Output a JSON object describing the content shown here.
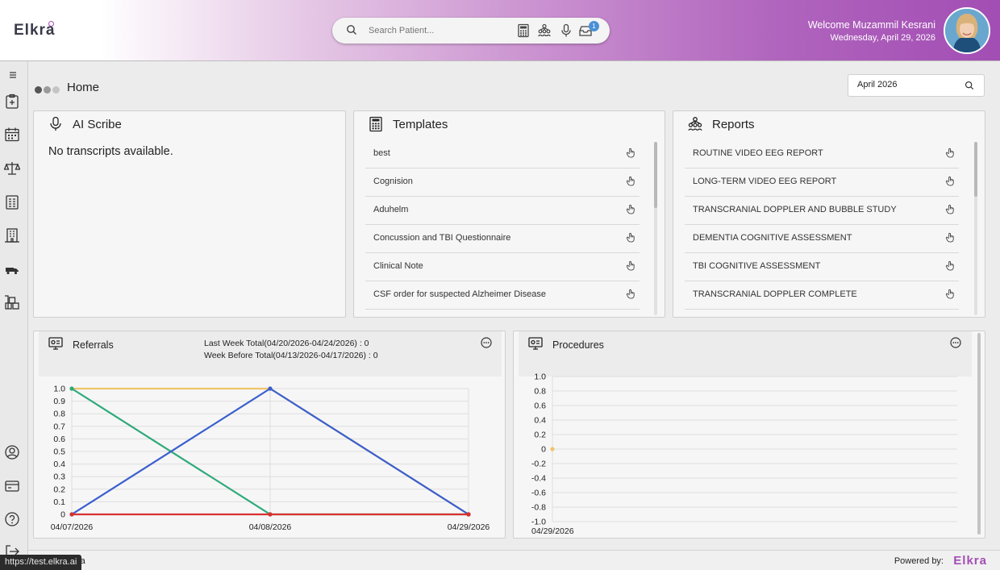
{
  "app": {
    "logo": "Elkra"
  },
  "header": {
    "search_placeholder": "Search Patient...",
    "notification_count": "1",
    "welcome": "Welcome Muzammil Kesrani",
    "date": "Wednesday, April 29, 2026"
  },
  "page": {
    "title": "Home",
    "month_value": "April 2026"
  },
  "ai_scribe": {
    "title": "AI Scribe",
    "empty": "No transcripts available."
  },
  "templates": {
    "title": "Templates",
    "items": [
      "best",
      "Cognision",
      "Aduhelm",
      "Concussion and TBI Questionnaire",
      "Clinical Note",
      "CSF order for suspected Alzheimer Disease"
    ]
  },
  "reports": {
    "title": "Reports",
    "items": [
      "ROUTINE VIDEO EEG REPORT",
      "LONG-TERM VIDEO EEG REPORT",
      "TRANSCRANIAL DOPPLER AND BUBBLE STUDY",
      "DEMENTIA COGNITIVE ASSESSMENT",
      "TBI COGNITIVE ASSESSMENT",
      "TRANSCRANIAL DOPPLER COMPLETE"
    ]
  },
  "referrals": {
    "title": "Referrals",
    "last_week": "Last Week Total(04/20/2026-04/24/2026) : 0",
    "week_before": "Week Before Total(04/13/2026-04/17/2026) : 0"
  },
  "procedures": {
    "title": "Procedures"
  },
  "footer": {
    "powered_by": "Powered by:",
    "logo": "Elkra",
    "url": "https://test.elkra.ai",
    "fragment": "ra"
  },
  "colors": {
    "accent": "#a24eb4",
    "series_yellow": "#efc46a",
    "series_green": "#2eaa7a",
    "series_blue": "#3a5fcf",
    "series_red": "#d93030"
  },
  "chart_data": [
    {
      "type": "line",
      "categories": [
        "04/07/2026",
        "04/08/2026",
        "04/29/2026"
      ],
      "y_ticks": [
        "1.0",
        "0.9",
        "0.8",
        "0.7",
        "0.6",
        "0.5",
        "0.4",
        "0.3",
        "0.2",
        "0.1",
        "0"
      ],
      "ylim": [
        0,
        1
      ],
      "grid": true,
      "series": [
        {
          "color": "#efc46a",
          "values": [
            1,
            1,
            0
          ]
        },
        {
          "color": "#2eaa7a",
          "values": [
            1,
            0,
            0
          ]
        },
        {
          "color": "#3a5fcf",
          "values": [
            0,
            1,
            0
          ]
        },
        {
          "color": "#d93030",
          "values": [
            0,
            0,
            0
          ]
        }
      ]
    },
    {
      "type": "line",
      "categories": [
        "04/29/2026"
      ],
      "y_ticks": [
        "1.0",
        "0.8",
        "0.6",
        "0.4",
        "0.2",
        "0",
        "-0.2",
        "-0.4",
        "-0.6",
        "-0.8",
        "-1.0"
      ],
      "ylim": [
        -1,
        1
      ],
      "grid": true,
      "series": [
        {
          "color": "#efc46a",
          "values": [
            0
          ]
        }
      ]
    }
  ]
}
